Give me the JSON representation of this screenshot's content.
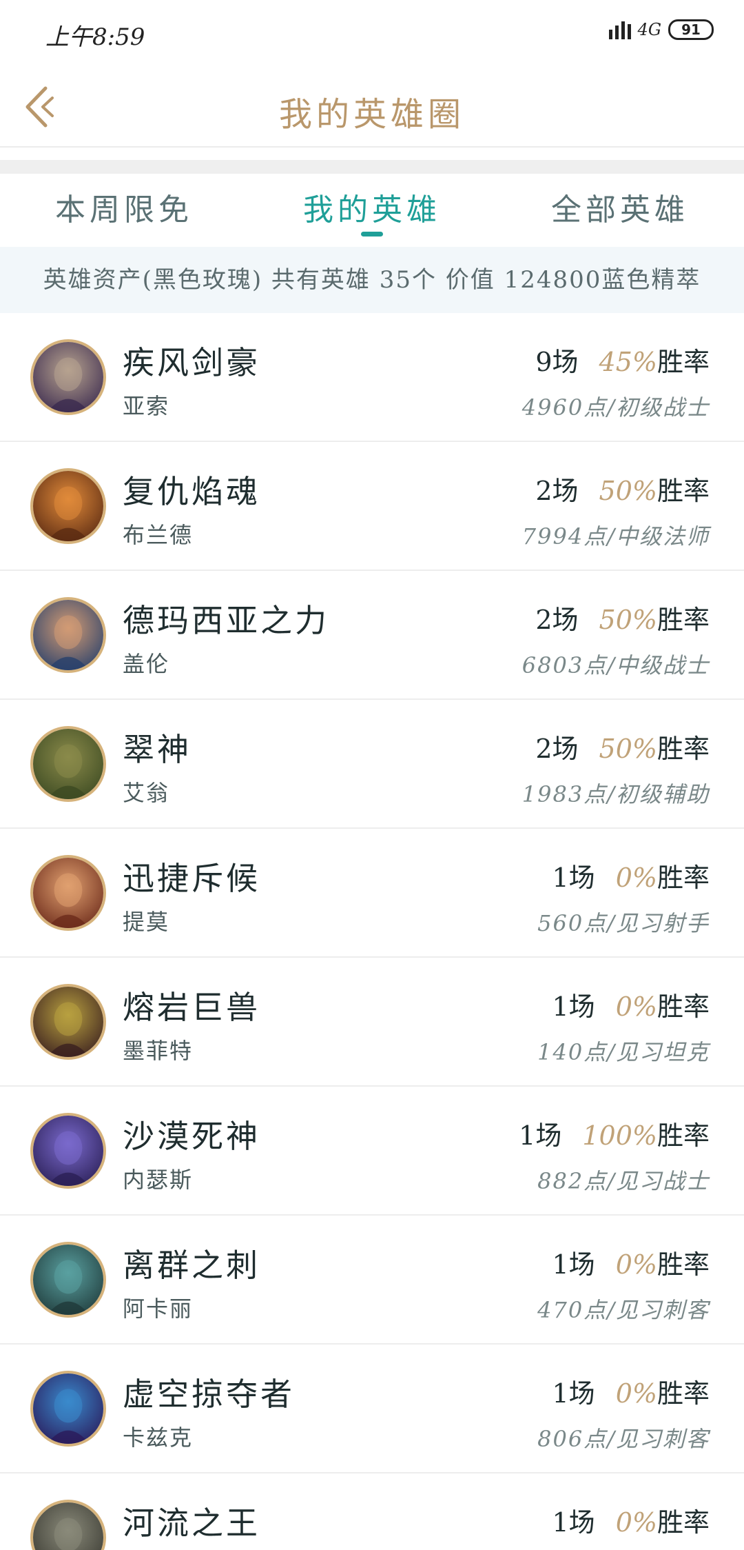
{
  "status": {
    "time": "上午8:59",
    "network": "4G",
    "battery": "91"
  },
  "header": {
    "title": "我的英雄圈"
  },
  "tabs": [
    {
      "label": "本周限免"
    },
    {
      "label": "我的英雄"
    },
    {
      "label": "全部英雄"
    }
  ],
  "summary": "英雄资产(黑色玫瑰) 共有英雄 35个 价值 124800蓝色精萃",
  "heroes": [
    {
      "title": "疾风剑豪",
      "name": "亚索",
      "games": "9场",
      "win_pct": "45%",
      "win_label": "胜率",
      "points": "4960点/初级战士",
      "colors": [
        "#3b2a4f",
        "#b7a38f"
      ]
    },
    {
      "title": "复仇焰魂",
      "name": "布兰德",
      "games": "2场",
      "win_pct": "50%",
      "win_label": "胜率",
      "points": "7994点/中级法师",
      "colors": [
        "#5a2a12",
        "#e08a3a"
      ]
    },
    {
      "title": "德玛西亚之力",
      "name": "盖伦",
      "games": "2场",
      "win_pct": "50%",
      "win_label": "胜率",
      "points": "6803点/中级战士",
      "colors": [
        "#27406b",
        "#d29b74"
      ]
    },
    {
      "title": "翠神",
      "name": "艾翁",
      "games": "2场",
      "win_pct": "50%",
      "win_label": "胜率",
      "points": "1983点/初级辅助",
      "colors": [
        "#3c4a22",
        "#8a8a4a"
      ]
    },
    {
      "title": "迅捷斥候",
      "name": "提莫",
      "games": "1场",
      "win_pct": "0%",
      "win_label": "胜率",
      "points": "560点/见习射手",
      "colors": [
        "#6b2a1a",
        "#e0a070"
      ]
    },
    {
      "title": "熔岩巨兽",
      "name": "墨菲特",
      "games": "1场",
      "win_pct": "0%",
      "win_label": "胜率",
      "points": "140点/见习坦克",
      "colors": [
        "#3a1f1f",
        "#b8a040"
      ]
    },
    {
      "title": "沙漠死神",
      "name": "内瑟斯",
      "games": "1场",
      "win_pct": "100%",
      "win_label": "胜率",
      "points": "882点/见习战士",
      "colors": [
        "#2a1f55",
        "#7a6acc"
      ]
    },
    {
      "title": "离群之刺",
      "name": "阿卡丽",
      "games": "1场",
      "win_pct": "0%",
      "win_label": "胜率",
      "points": "470点/见习刺客",
      "colors": [
        "#1f3a3a",
        "#5aa0a0"
      ]
    },
    {
      "title": "虚空掠夺者",
      "name": "卡兹克",
      "games": "1场",
      "win_pct": "0%",
      "win_label": "胜率",
      "points": "806点/见习刺客",
      "colors": [
        "#2a1a5a",
        "#3a8acc"
      ]
    },
    {
      "title": "河流之王",
      "name": "",
      "games": "1场",
      "win_pct": "0%",
      "win_label": "胜率",
      "points": "",
      "colors": [
        "#3a3a32",
        "#8a8a7a"
      ]
    }
  ],
  "accent_color": "#1f9f98",
  "gold_color": "#b9976b"
}
